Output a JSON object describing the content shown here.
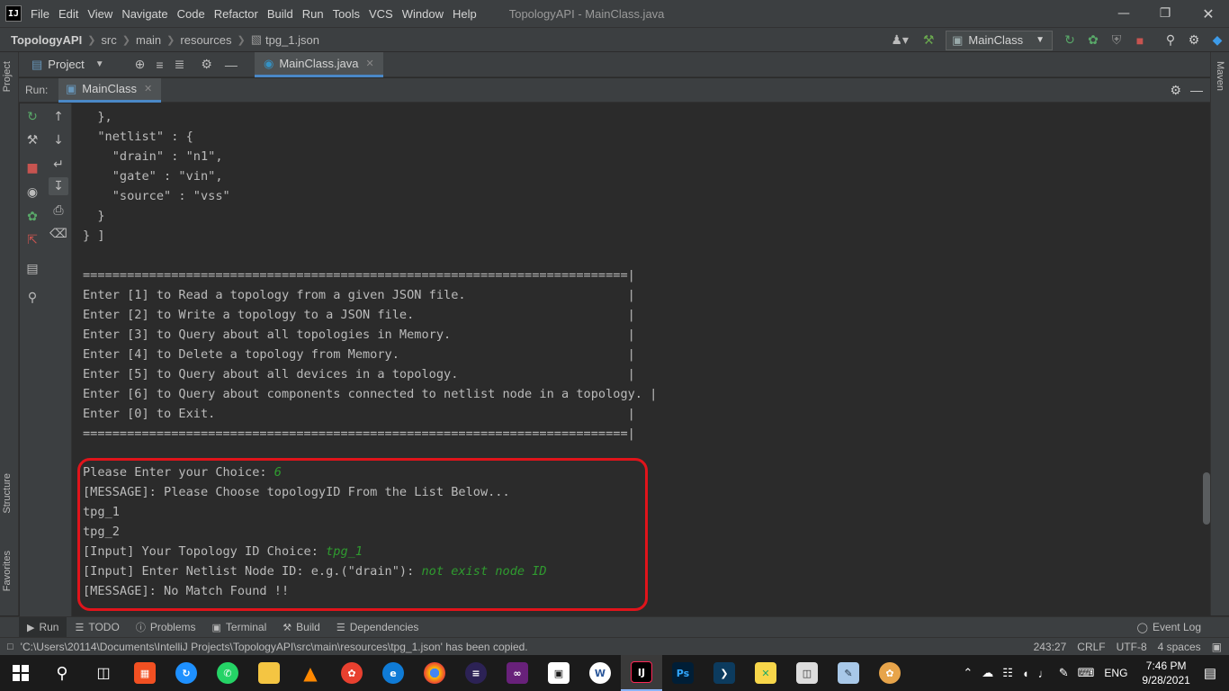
{
  "app": {
    "logo": "IJ",
    "window_title": "TopologyAPI - MainClass.java",
    "menu": [
      "File",
      "Edit",
      "View",
      "Navigate",
      "Code",
      "Refactor",
      "Build",
      "Run",
      "Tools",
      "VCS",
      "Window",
      "Help"
    ]
  },
  "navbar": {
    "breadcrumbs": [
      "TopologyAPI",
      "src",
      "main",
      "resources",
      "tpg_1.json"
    ],
    "run_config": "MainClass"
  },
  "side_tabs": {
    "left": [
      "Project",
      "Structure",
      "Favorites"
    ],
    "right": [
      "Maven"
    ]
  },
  "tabbar": {
    "project_label": "Project",
    "editor_tab": "MainClass.java"
  },
  "run_panel": {
    "label": "Run:",
    "tab": "MainClass"
  },
  "console": {
    "lines": [
      "  },",
      "  \"netlist\" : {",
      "    \"drain\" : \"n1\",",
      "    \"gate\" : \"vin\",",
      "    \"source\" : \"vss\"",
      "  }",
      "} ]",
      "",
      "==========================================================================|",
      "Enter [1] to Read a topology from a given JSON file.                      |",
      "Enter [2] to Write a topology to a JSON file.                             |",
      "Enter [3] to Query about all topologies in Memory.                        |",
      "Enter [4] to Delete a topology from Memory.                               |",
      "Enter [5] to Query about all devices in a topology.                       |",
      "Enter [6] to Query about components connected to netlist node in a topology. |",
      "Enter [0] to Exit.                                                        |",
      "==========================================================================|",
      ""
    ],
    "interaction": [
      {
        "text": "Please Enter your Choice: ",
        "input": "6"
      },
      {
        "text": "[MESSAGE]: Please Choose topologyID From the List Below...",
        "input": ""
      },
      {
        "text": "tpg_1",
        "input": ""
      },
      {
        "text": "tpg_2",
        "input": ""
      },
      {
        "text": "[Input] Your Topology ID Choice: ",
        "input": "tpg_1"
      },
      {
        "text": "[Input] Enter Netlist Node ID: e.g.(\"drain\"): ",
        "input": "not exist node ID"
      },
      {
        "text": "[MESSAGE]: No Match Found !!",
        "input": ""
      }
    ]
  },
  "bottom_tools": [
    "Run",
    "TODO",
    "Problems",
    "Terminal",
    "Build",
    "Dependencies"
  ],
  "event_log": "Event Log",
  "status": {
    "message": "'C:\\Users\\20114\\Documents\\IntelliJ Projects\\TopologyAPI\\src\\main\\resources\\tpg_1.json' has been copied.",
    "position": "243:27",
    "line_sep": "CRLF",
    "encoding": "UTF-8",
    "indent": "4 spaces"
  },
  "taskbar": {
    "apps": [
      "Store",
      "Sync",
      "WhatsApp",
      "Explorer",
      "VLC",
      "Baidu",
      "Edge",
      "Chrome",
      "Eclipse",
      "Visual Studio",
      "Portal",
      "Word",
      "IntelliJ",
      "Photoshop",
      "Terminal",
      "Sketch",
      "Database",
      "Notes",
      "Paint"
    ],
    "language": "ENG",
    "time": "7:46 PM",
    "date": "9/28/2021"
  },
  "colors": {
    "highlight": "#e0141b",
    "user_input": "#2f9b2f",
    "accent": "#4a88c7"
  }
}
